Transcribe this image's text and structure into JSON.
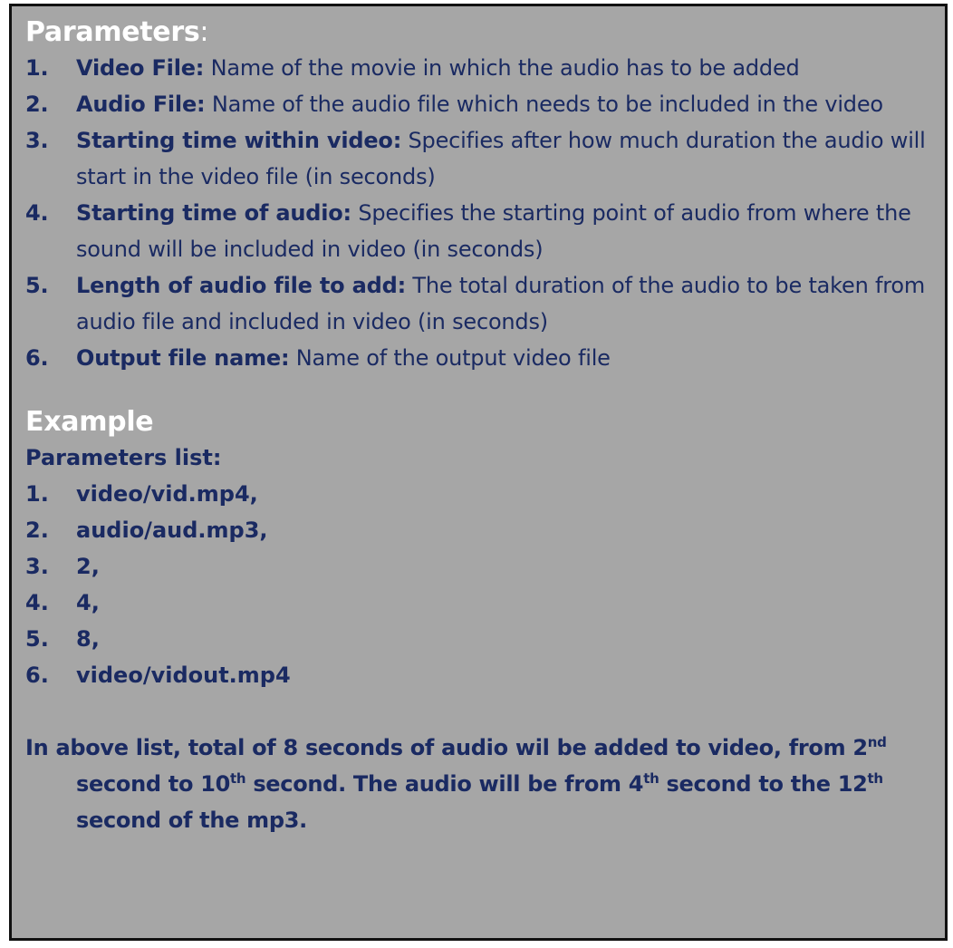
{
  "parameters": {
    "heading": "Parameters",
    "colon": ":",
    "items": [
      {
        "num": "1.",
        "term": "Video File:",
        "desc": " Name of the movie in which the audio has to be added"
      },
      {
        "num": "2.",
        "term": "Audio File:",
        "desc": " Name of the audio file which needs to be included in the video"
      },
      {
        "num": "3.",
        "term": "Starting time within video:",
        "desc": " Specifies after how much duration the audio will start in the video file (in seconds)"
      },
      {
        "num": "4.",
        "term": "Starting time of audio:",
        "desc": " Specifies the starting point of audio from where the sound will be included in video (in seconds)"
      },
      {
        "num": "5.",
        "term": "Length of audio file to add:",
        "desc": " The total duration of the audio to be taken from audio file and included in video (in seconds)"
      },
      {
        "num": "6.",
        "term": "Output file name:",
        "desc": " Name of the output video file"
      }
    ]
  },
  "example": {
    "heading": "Example",
    "list_label": "Parameters list:",
    "items": [
      {
        "num": "1.",
        "value": "video/vid.mp4,"
      },
      {
        "num": "2.",
        "value": "audio/aud.mp3,"
      },
      {
        "num": "3.",
        "value": "2,"
      },
      {
        "num": "4.",
        "value": "4,"
      },
      {
        "num": "5.",
        "value": "8,"
      },
      {
        "num": "6.",
        "value": "video/vidout.mp4"
      }
    ],
    "note": {
      "part1": "In above list, total of 8 seconds of audio wil be added to video, from 2",
      "sup1": "nd",
      "part2": " second to  10",
      "sup2": "th",
      "part3": " second. The audio will be from 4",
      "sup3": "th",
      "part4": " second to the 12",
      "sup4": "th",
      "part5": " second of the mp3."
    }
  },
  "colors": {
    "panel_background": "#a6a6a6",
    "text_navy": "#1a2a62",
    "heading_white": "#ffffff",
    "border": "#111111"
  }
}
